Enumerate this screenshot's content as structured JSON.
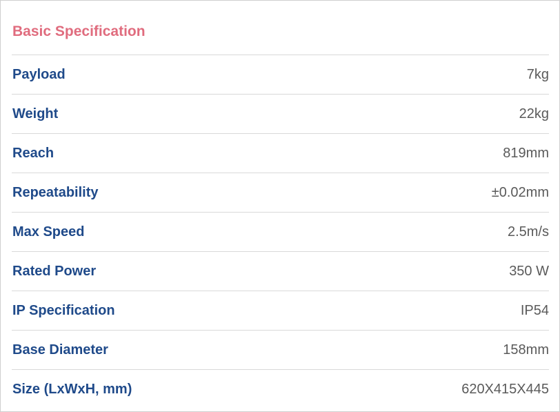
{
  "section": {
    "title": "Basic Specification"
  },
  "specs": [
    {
      "label": "Payload",
      "value": "7kg"
    },
    {
      "label": "Weight",
      "value": "22kg"
    },
    {
      "label": "Reach",
      "value": "819mm"
    },
    {
      "label": "Repeatability",
      "value": "±0.02mm"
    },
    {
      "label": "Max Speed",
      "value": "2.5m/s"
    },
    {
      "label": "Rated Power",
      "value": "350 W"
    },
    {
      "label": "IP Specification",
      "value": "IP54"
    },
    {
      "label": "Base Diameter",
      "value": "158mm"
    },
    {
      "label": "Size (LxWxH, mm)",
      "value": "620X415X445"
    }
  ],
  "colors": {
    "title": "#e06c7e",
    "label": "#1f4a8a",
    "value": "#5a5a5a",
    "divider": "#d9d9d9",
    "border": "#cfcfcf"
  }
}
